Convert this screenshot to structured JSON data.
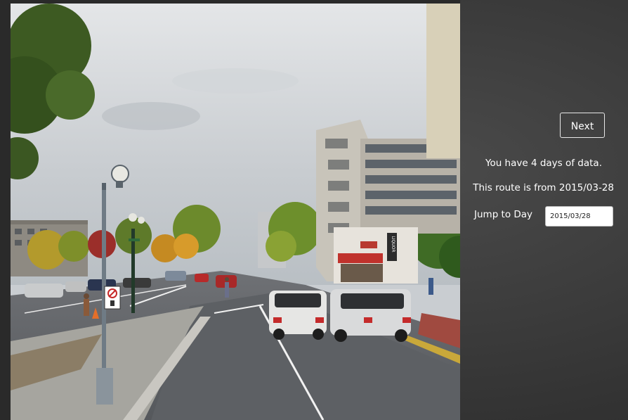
{
  "colors": {
    "background": "#3a3a3a",
    "text": "#ffffff",
    "button_border": "#e8e8e8",
    "input_background": "#ffffff"
  },
  "streetview": {
    "icons": [
      "street-lamp-icon",
      "no-parking-sign-icon",
      "liquor-sign-icon"
    ],
    "liquor_sign": "LIQUOR"
  },
  "panel": {
    "next_label": "Next",
    "days_text": "You have 4 days of data.",
    "route_text": "This route is from 2015/03-28",
    "jump_label": "Jump to Day",
    "jump_value": "2015/03/28"
  }
}
